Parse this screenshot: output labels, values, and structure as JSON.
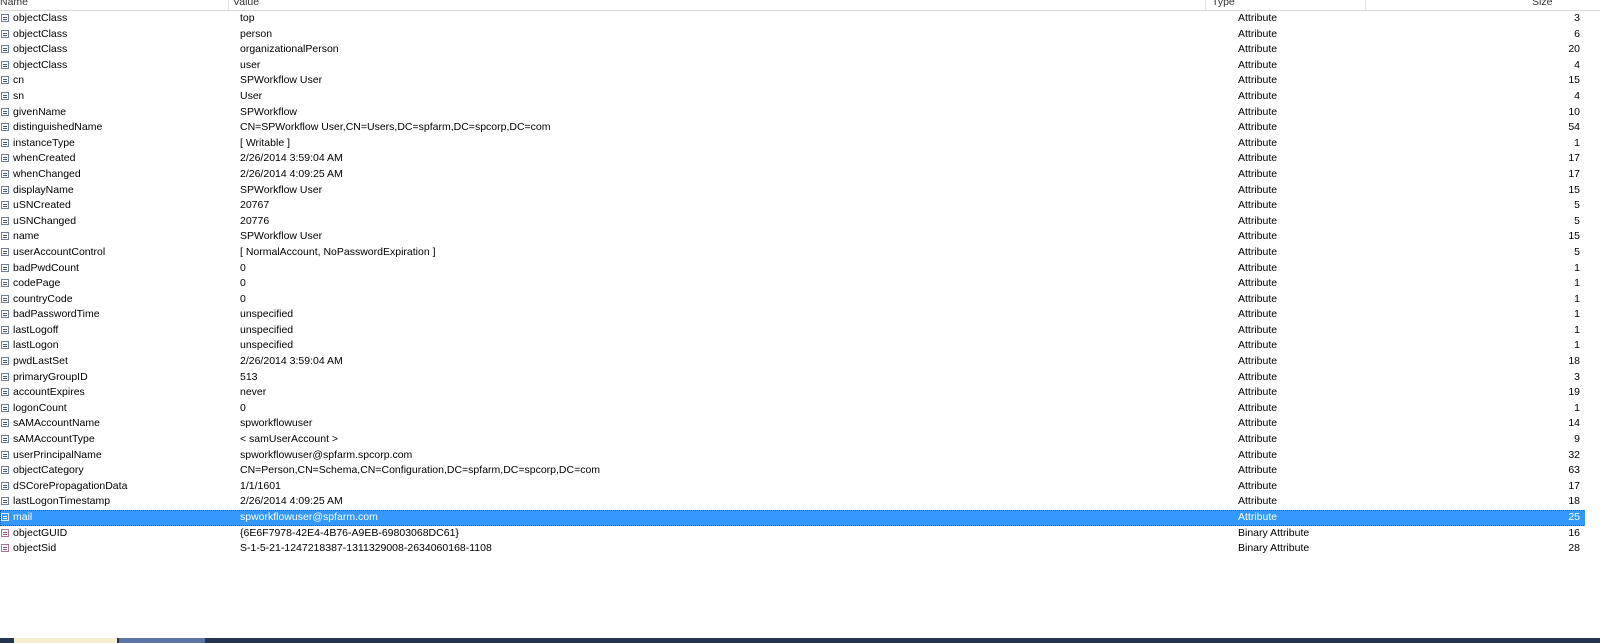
{
  "header": {
    "name": "Name",
    "value": "Value",
    "type": "Type",
    "size": "Size"
  },
  "selected_index": 32,
  "rows": [
    {
      "name": "objectClass",
      "value": "top",
      "type": "Attribute",
      "size": "3",
      "kind": "attr"
    },
    {
      "name": "objectClass",
      "value": "person",
      "type": "Attribute",
      "size": "6",
      "kind": "attr"
    },
    {
      "name": "objectClass",
      "value": "organizationalPerson",
      "type": "Attribute",
      "size": "20",
      "kind": "attr"
    },
    {
      "name": "objectClass",
      "value": "user",
      "type": "Attribute",
      "size": "4",
      "kind": "attr"
    },
    {
      "name": "cn",
      "value": "SPWorkflow User",
      "type": "Attribute",
      "size": "15",
      "kind": "attr"
    },
    {
      "name": "sn",
      "value": "User",
      "type": "Attribute",
      "size": "4",
      "kind": "attr"
    },
    {
      "name": "givenName",
      "value": "SPWorkflow",
      "type": "Attribute",
      "size": "10",
      "kind": "attr"
    },
    {
      "name": "distinguishedName",
      "value": "CN=SPWorkflow User,CN=Users,DC=spfarm,DC=spcorp,DC=com",
      "type": "Attribute",
      "size": "54",
      "kind": "attr"
    },
    {
      "name": "instanceType",
      "value": "[ Writable ]",
      "type": "Attribute",
      "size": "1",
      "kind": "attr"
    },
    {
      "name": "whenCreated",
      "value": "2/26/2014 3:59:04 AM",
      "type": "Attribute",
      "size": "17",
      "kind": "attr"
    },
    {
      "name": "whenChanged",
      "value": "2/26/2014 4:09:25 AM",
      "type": "Attribute",
      "size": "17",
      "kind": "attr"
    },
    {
      "name": "displayName",
      "value": "SPWorkflow User",
      "type": "Attribute",
      "size": "15",
      "kind": "attr"
    },
    {
      "name": "uSNCreated",
      "value": "20767",
      "type": "Attribute",
      "size": "5",
      "kind": "attr"
    },
    {
      "name": "uSNChanged",
      "value": "20776",
      "type": "Attribute",
      "size": "5",
      "kind": "attr"
    },
    {
      "name": "name",
      "value": "SPWorkflow User",
      "type": "Attribute",
      "size": "15",
      "kind": "attr"
    },
    {
      "name": "userAccountControl",
      "value": "[ NormalAccount, NoPasswordExpiration ]",
      "type": "Attribute",
      "size": "5",
      "kind": "attr"
    },
    {
      "name": "badPwdCount",
      "value": "0",
      "type": "Attribute",
      "size": "1",
      "kind": "attr"
    },
    {
      "name": "codePage",
      "value": "0",
      "type": "Attribute",
      "size": "1",
      "kind": "attr"
    },
    {
      "name": "countryCode",
      "value": "0",
      "type": "Attribute",
      "size": "1",
      "kind": "attr"
    },
    {
      "name": "badPasswordTime",
      "value": "unspecified",
      "type": "Attribute",
      "size": "1",
      "kind": "attr"
    },
    {
      "name": "lastLogoff",
      "value": "unspecified",
      "type": "Attribute",
      "size": "1",
      "kind": "attr"
    },
    {
      "name": "lastLogon",
      "value": "unspecified",
      "type": "Attribute",
      "size": "1",
      "kind": "attr"
    },
    {
      "name": "pwdLastSet",
      "value": "2/26/2014 3:59:04 AM",
      "type": "Attribute",
      "size": "18",
      "kind": "attr"
    },
    {
      "name": "primaryGroupID",
      "value": "513",
      "type": "Attribute",
      "size": "3",
      "kind": "attr"
    },
    {
      "name": "accountExpires",
      "value": "never",
      "type": "Attribute",
      "size": "19",
      "kind": "attr"
    },
    {
      "name": "logonCount",
      "value": "0",
      "type": "Attribute",
      "size": "1",
      "kind": "attr"
    },
    {
      "name": "sAMAccountName",
      "value": "spworkflowuser",
      "type": "Attribute",
      "size": "14",
      "kind": "attr"
    },
    {
      "name": "sAMAccountType",
      "value": "< samUserAccount >",
      "type": "Attribute",
      "size": "9",
      "kind": "attr"
    },
    {
      "name": "userPrincipalName",
      "value": "spworkflowuser@spfarm.spcorp.com",
      "type": "Attribute",
      "size": "32",
      "kind": "attr"
    },
    {
      "name": "objectCategory",
      "value": "CN=Person,CN=Schema,CN=Configuration,DC=spfarm,DC=spcorp,DC=com",
      "type": "Attribute",
      "size": "63",
      "kind": "attr"
    },
    {
      "name": "dSCorePropagationData",
      "value": "1/1/1601",
      "type": "Attribute",
      "size": "17",
      "kind": "attr"
    },
    {
      "name": "lastLogonTimestamp",
      "value": "2/26/2014 4:09:25 AM",
      "type": "Attribute",
      "size": "18",
      "kind": "attr"
    },
    {
      "name": "mail",
      "value": "spworkflowuser@spfarm.com",
      "type": "Attribute",
      "size": "25",
      "kind": "attr"
    },
    {
      "name": "objectGUID",
      "value": "{6E6F7978-42E4-4B76-A9EB-69803068DC61}",
      "type": "Binary Attribute",
      "size": "16",
      "kind": "binary"
    },
    {
      "name": "objectSid",
      "value": "S-1-5-21-1247218387-1311329008-2634060168-1108",
      "type": "Binary Attribute",
      "size": "28",
      "kind": "binary"
    }
  ]
}
